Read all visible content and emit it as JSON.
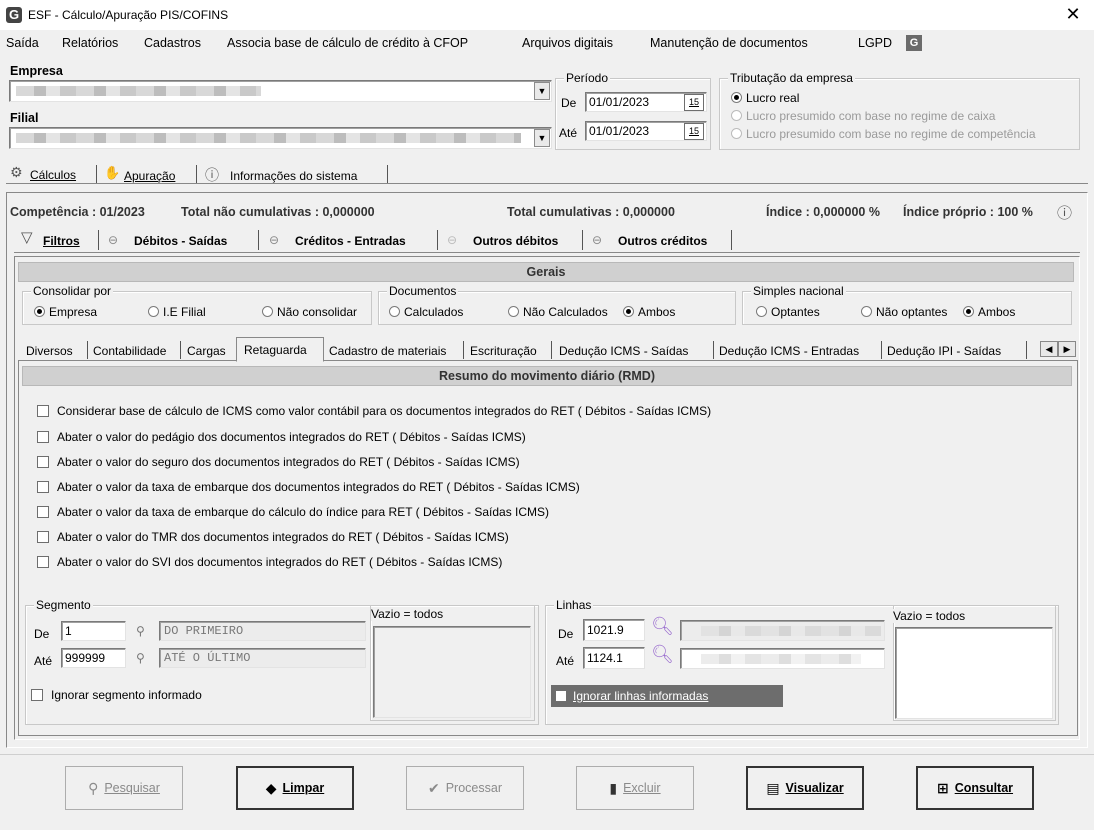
{
  "window": {
    "title": "ESF - Cálculo/Apuração PIS/COFINS",
    "logo": "G",
    "close": "✕"
  },
  "menu": [
    "Saída",
    "Relatórios",
    "Cadastros",
    "Associa base de cálculo de crédito à CFOP",
    "Arquivos digitais",
    "Manutenção de documentos",
    "LGPD"
  ],
  "menu_logo": "G",
  "empresa": {
    "label": "Empresa"
  },
  "filial": {
    "label": "Filial"
  },
  "periodo": {
    "title": "Período",
    "de_label": "De",
    "de_value": "01/01/2023",
    "ate_label": "Até",
    "ate_value": "01/01/2023",
    "cal": "15"
  },
  "tributacao": {
    "title": "Tributação da empresa",
    "options": [
      "Lucro real",
      "Lucro presumido com base no regime de caixa",
      "Lucro presumido com base no regime de competência"
    ],
    "selected": 0
  },
  "main_tabs": [
    "Cálculos",
    "Apuração",
    "Informações do sistema"
  ],
  "summary": {
    "competencia": "Competência : 01/2023",
    "total_nao_cum": "Total não cumulativas : 0,000000",
    "total_cum": "Total cumulativas : 0,000000",
    "indice": "Índice : 0,000000 %",
    "indice_proprio": "Índice próprio : 100 %"
  },
  "sub_tabs": [
    "Filtros",
    "Débitos - Saídas",
    "Créditos - Entradas",
    "Outros débitos",
    "Outros créditos"
  ],
  "gerais": {
    "title": "Gerais",
    "consolidar": {
      "title": "Consolidar por",
      "options": [
        "Empresa",
        "I.E Filial",
        "Não consolidar"
      ],
      "selected": 0
    },
    "documentos": {
      "title": "Documentos",
      "options": [
        "Calculados",
        "Não Calculados",
        "Ambos"
      ],
      "selected": 2
    },
    "simples": {
      "title": "Simples nacional",
      "options": [
        "Optantes",
        "Não optantes",
        "Ambos"
      ],
      "selected": 2
    }
  },
  "filter_tabs": [
    "Diversos",
    "Contabilidade",
    "Cargas",
    "Retaguarda",
    "Cadastro de materiais",
    "Escrituração",
    "Dedução ICMS - Saídas",
    "Dedução ICMS - Entradas",
    "Dedução IPI - Saídas"
  ],
  "active_filter_tab": "Retaguarda",
  "rmd": {
    "title": "Resumo do movimento diário (RMD)",
    "checks": [
      "Considerar base de cálculo de ICMS como valor contábil para os documentos integrados do RET ( Débitos - Saídas ICMS)",
      "Abater o valor do pedágio dos documentos integrados do RET ( Débitos - Saídas ICMS)",
      "Abater o valor do seguro dos documentos integrados do RET ( Débitos - Saídas ICMS)",
      "Abater o valor da taxa de embarque dos documentos integrados do RET ( Débitos - Saídas ICMS)",
      "Abater o valor da taxa de embarque do cálculo do índice para RET ( Débitos - Saídas ICMS)",
      "Abater o valor do TMR dos documentos integrados do RET ( Débitos - Saídas ICMS)",
      "Abater o valor do SVI dos documentos integrados do RET ( Débitos - Saídas ICMS)"
    ]
  },
  "segmento": {
    "title": "Segmento",
    "de_label": "De",
    "de_value": "1",
    "de_desc": "DO PRIMEIRO",
    "ate_label": "Até",
    "ate_value": "999999",
    "ate_desc": "ATÉ O ÚLTIMO",
    "vazio": "Vazio = todos",
    "ignorar": "Ignorar segmento informado"
  },
  "linhas": {
    "title": "Linhas",
    "de_label": "De",
    "de_value": "1021.9",
    "ate_label": "Até",
    "ate_value": "1124.1",
    "vazio": "Vazio = todos",
    "ignorar": "Ignorar linhas informadas"
  },
  "buttons": [
    {
      "label": "Pesquisar",
      "u": "P",
      "icon": "search-icon",
      "state": "inactive"
    },
    {
      "label": "Limpar",
      "u": "L",
      "icon": "eraser-icon",
      "state": "active"
    },
    {
      "label": "Processar",
      "u": "r",
      "icon": "check-icon",
      "state": "inactive"
    },
    {
      "label": "Excluir",
      "u": "E",
      "icon": "trash-icon",
      "state": "inactive"
    },
    {
      "label": "Visualizar",
      "u": "V",
      "icon": "printer-icon",
      "state": "active"
    },
    {
      "label": "Consultar",
      "u": "C",
      "icon": "table-icon",
      "state": "active"
    }
  ]
}
